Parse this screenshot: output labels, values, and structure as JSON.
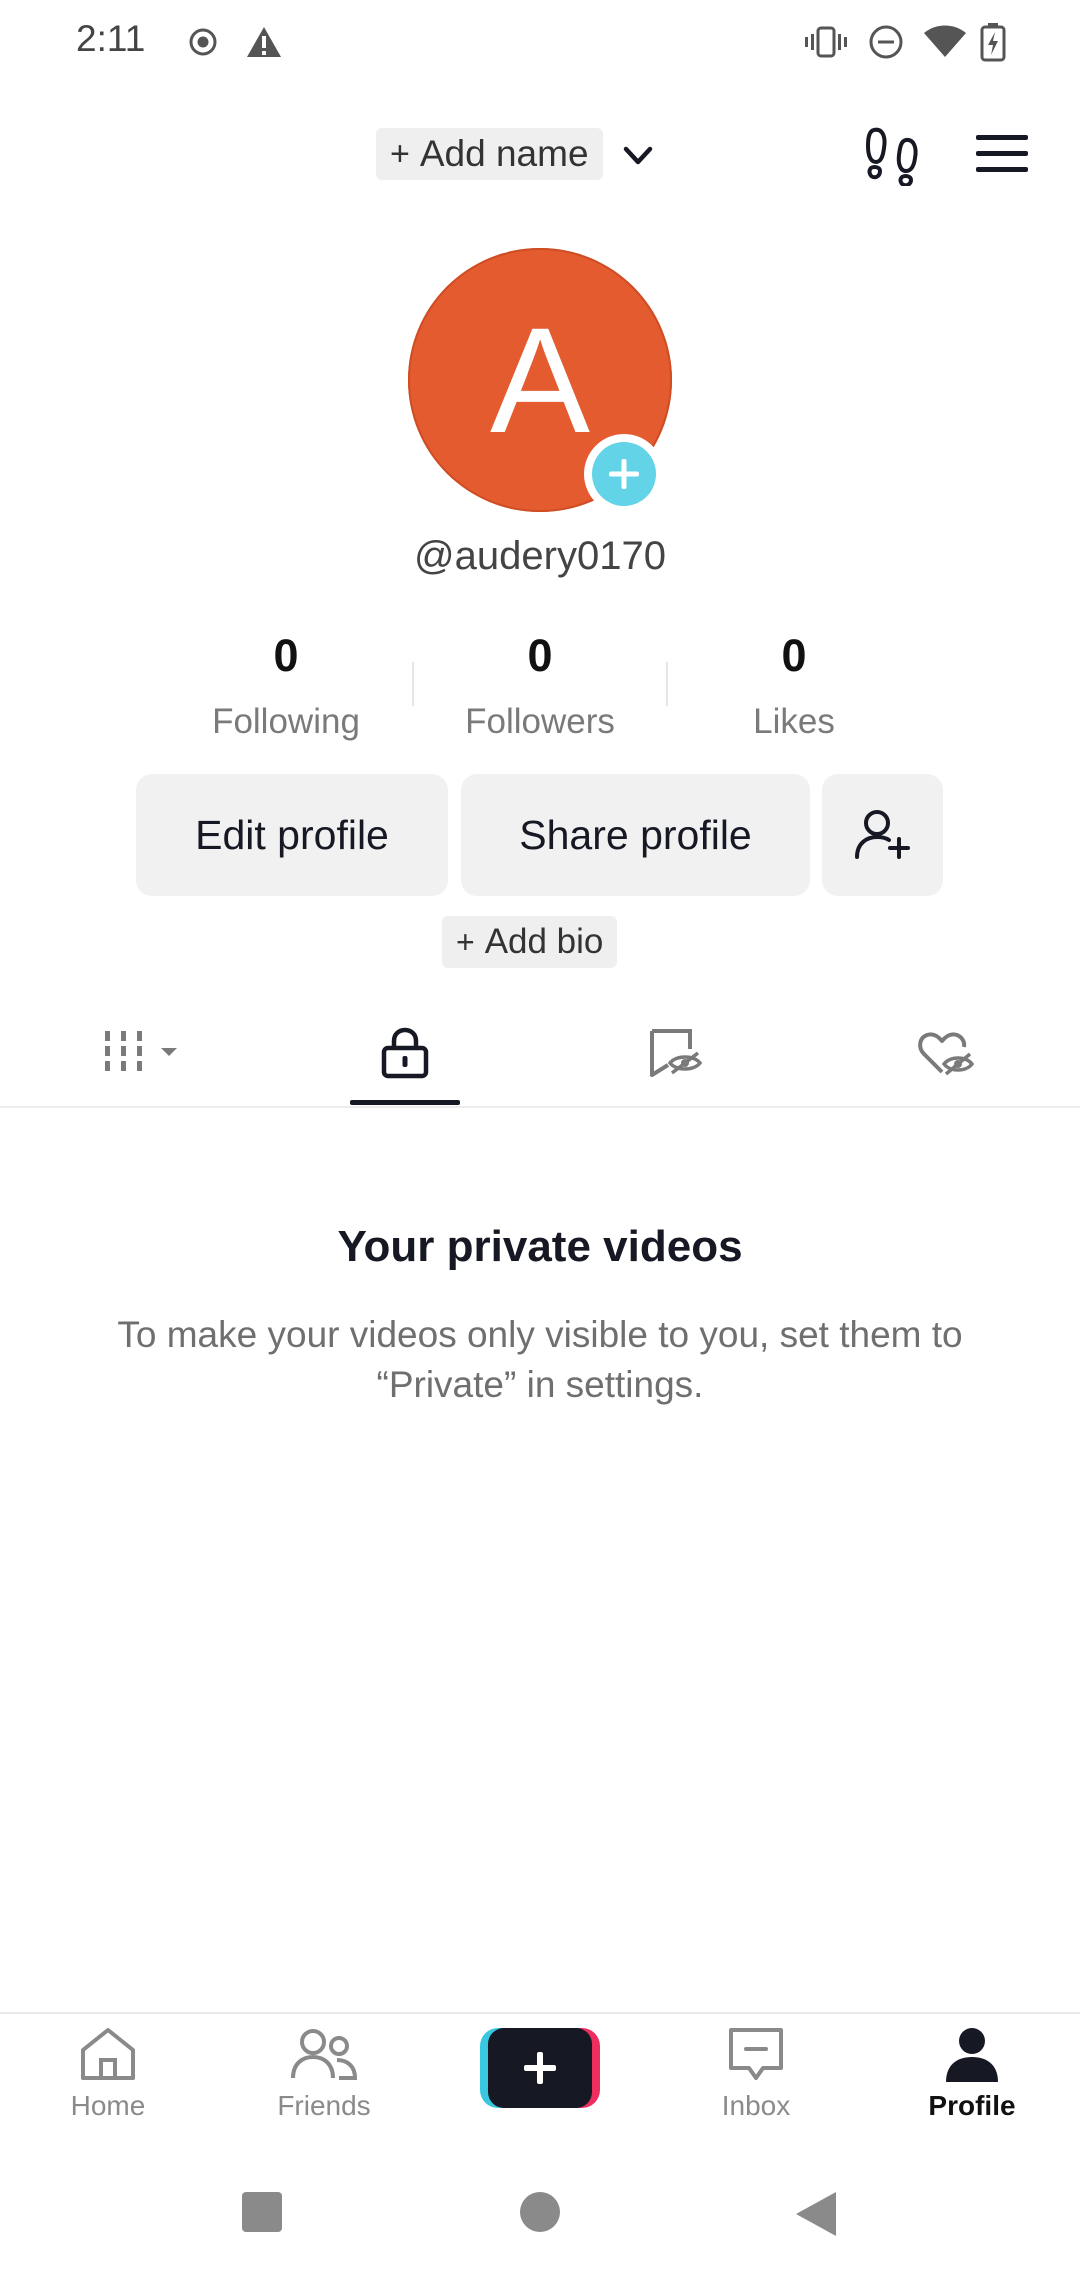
{
  "status_bar": {
    "time": "2:11",
    "icons": [
      "record-icon",
      "warning-icon",
      "vibrate-icon",
      "dnd-icon",
      "wifi-icon",
      "battery-charging-icon"
    ]
  },
  "header": {
    "add_name_label": "Add name",
    "add_name_plus": "+",
    "icons": [
      "chevron-down-icon",
      "footprints-icon",
      "menu-icon"
    ]
  },
  "profile": {
    "avatar_letter": "A",
    "avatar_color": "#e35b2f",
    "add_badge_color": "#63d3e7",
    "username": "@audery0170",
    "stats": [
      {
        "value": "0",
        "label": "Following"
      },
      {
        "value": "0",
        "label": "Followers"
      },
      {
        "value": "0",
        "label": "Likes"
      }
    ],
    "edit_profile_label": "Edit profile",
    "share_profile_label": "Share profile",
    "add_bio_plus": "+",
    "add_bio_label": "Add bio"
  },
  "tabs": {
    "items": [
      "videos-grid-icon",
      "lock-icon",
      "reposts-hidden-icon",
      "liked-hidden-icon"
    ],
    "active": "lock-icon"
  },
  "empty_state": {
    "title": "Your private videos",
    "text": "To make your videos only visible to you, set them to “Private” in settings."
  },
  "bottom_nav": {
    "home": "Home",
    "friends": "Friends",
    "inbox": "Inbox",
    "profile": "Profile",
    "active": "Profile"
  },
  "system_nav": [
    "recents-icon",
    "home-circle-icon",
    "back-icon"
  ]
}
